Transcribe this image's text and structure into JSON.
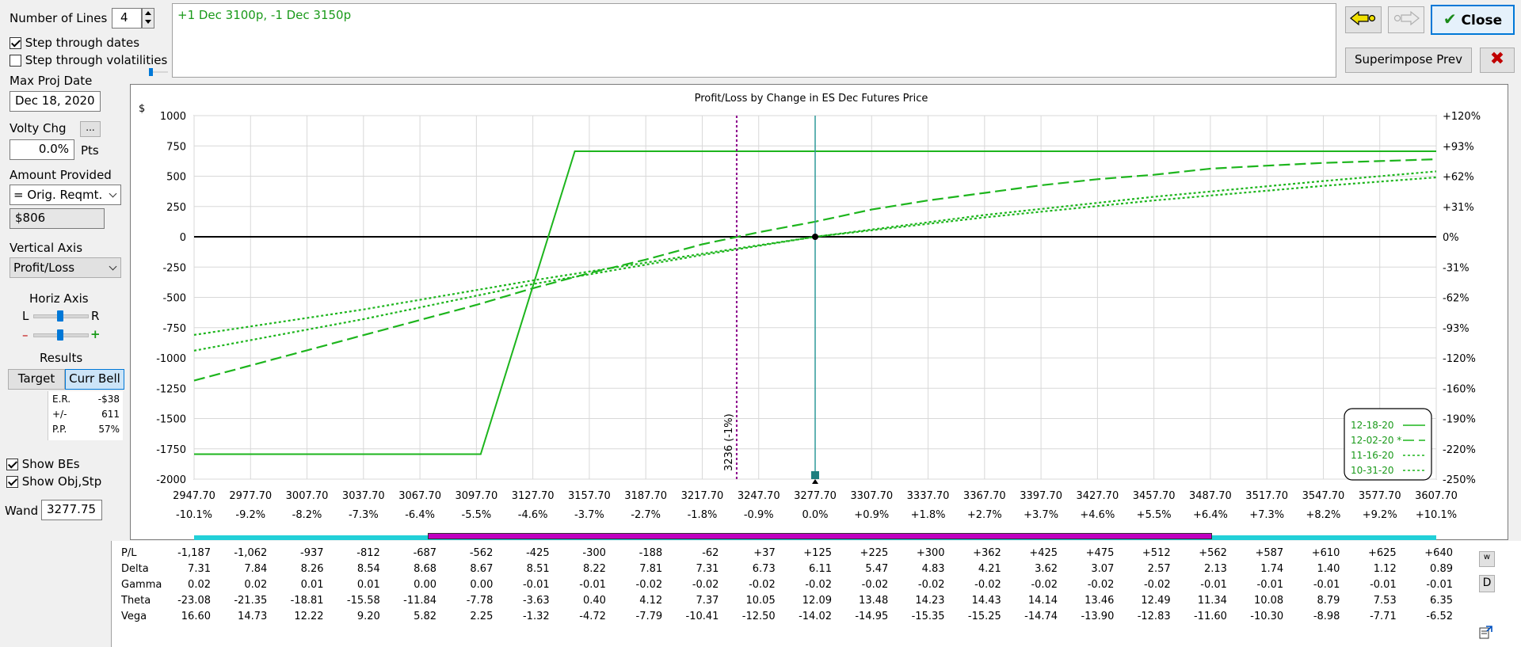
{
  "controls": {
    "num_lines_label": "Number of Lines",
    "num_lines_value": "4",
    "step_dates_label": "Step through dates",
    "step_dates_checked": true,
    "step_vols_label": "Step through volatilities",
    "step_vols_checked": false,
    "max_proj_date_label": "Max Proj Date",
    "max_proj_date_value": "Dec 18, 2020",
    "volty_chg_label": "Volty Chg",
    "volty_chg_button": "...",
    "volty_chg_value": "0.0%",
    "volty_units": "Pts",
    "amount_provided_label": "Amount Provided",
    "amount_provided_selected": "= Orig. Reqmt.",
    "amount_value": "$806",
    "vertical_axis_label": "Vertical Axis",
    "vertical_axis_selected": "Profit/Loss",
    "horiz_axis_label": "Horiz Axis",
    "horiz_left": "L",
    "horiz_right": "R",
    "horiz_minus": "–",
    "horiz_plus": "+",
    "results_label": "Results",
    "target_button": "Target",
    "curr_bell_button": "Curr Bell",
    "stats": [
      {
        "label": "E.R.",
        "value": "-$38"
      },
      {
        "label": "+/-",
        "value": "611"
      },
      {
        "label": "P.P.",
        "value": "57%"
      }
    ],
    "show_bes_label": "Show BEs",
    "show_bes_checked": true,
    "show_obj_label": "Show Obj,Stp",
    "show_obj_checked": true,
    "wand_label": "Wand",
    "wand_value": "3277.75"
  },
  "position_text": "+1 Dec 3100p, -1 Dec 3150p",
  "toolbar": {
    "close_label": "Close",
    "superimpose_label": "Superimpose Prev"
  },
  "colors": {
    "position_text": "#1a9a1a",
    "line": "#1db51d",
    "breakeven": "#8b008b",
    "wand_line": "#2e9a9a",
    "range_cyan": "#22d0d8",
    "range_magenta": "#c000c0"
  },
  "chart_data": {
    "type": "line",
    "title": "Profit/Loss by Change in ES Dec Futures Price",
    "ylabel_left": "$",
    "xlim": [
      2947.7,
      3607.7
    ],
    "ylim": [
      -2000,
      1000
    ],
    "x_ticks": [
      "2947.70",
      "2977.70",
      "3007.70",
      "3037.70",
      "3067.70",
      "3097.70",
      "3127.70",
      "3157.70",
      "3187.70",
      "3217.70",
      "3247.70",
      "3277.70",
      "3307.70",
      "3337.70",
      "3367.70",
      "3397.70",
      "3427.70",
      "3457.70",
      "3487.70",
      "3517.70",
      "3547.70",
      "3577.70",
      "3607.70"
    ],
    "x_pct_ticks": [
      "-10.1%",
      "-9.2%",
      "-8.2%",
      "-7.3%",
      "-6.4%",
      "-5.5%",
      "-4.6%",
      "-3.7%",
      "-2.7%",
      "-1.8%",
      "-0.9%",
      "0.0%",
      "+0.9%",
      "+1.8%",
      "+2.7%",
      "+3.7%",
      "+4.6%",
      "+5.5%",
      "+6.4%",
      "+7.3%",
      "+8.2%",
      "+9.2%",
      "+10.1%"
    ],
    "y_ticks": [
      1000,
      750,
      500,
      250,
      0,
      -250,
      -500,
      -750,
      -1000,
      -1250,
      -1500,
      -1750,
      -2000
    ],
    "y_right_ticks": [
      "+120%",
      "+93%",
      "+62%",
      "+31%",
      "0%",
      "-31%",
      "-62%",
      "-93%",
      "-120%",
      "-160%",
      "-190%",
      "-220%",
      "-250%"
    ],
    "breakeven": {
      "x": 3236,
      "label": "3236 (-1%)"
    },
    "current_price": 3277.7,
    "legend": [
      "12-18-20",
      "12-02-20 *",
      "11-16-20",
      "10-31-20"
    ],
    "series": [
      {
        "name": "12-18-20",
        "style": "solid",
        "x": [
          2947.7,
          3100,
          3150,
          3607.7
        ],
        "y": [
          -1794,
          -1794,
          706,
          706
        ]
      },
      {
        "name": "12-02-20 *",
        "style": "dashed",
        "x": [
          2947.7,
          2977.7,
          3007.7,
          3037.7,
          3067.7,
          3097.7,
          3127.7,
          3157.7,
          3187.7,
          3217.7,
          3247.7,
          3277.7,
          3307.7,
          3337.7,
          3367.7,
          3397.7,
          3427.7,
          3457.7,
          3487.7,
          3517.7,
          3547.7,
          3577.7,
          3607.7
        ],
        "y": [
          -1187,
          -1062,
          -937,
          -812,
          -687,
          -562,
          -425,
          -300,
          -188,
          -62,
          37,
          125,
          225,
          300,
          362,
          425,
          475,
          512,
          562,
          587,
          610,
          625,
          640
        ]
      },
      {
        "name": "11-16-20",
        "style": "dotted",
        "x": [
          2947.7,
          3037.7,
          3127.7,
          3217.7,
          3277.7,
          3367.7,
          3457.7,
          3547.7,
          3607.7
        ],
        "y": [
          -940,
          -680,
          -390,
          -150,
          0,
          180,
          330,
          460,
          540
        ]
      },
      {
        "name": "10-31-20",
        "style": "dotted",
        "x": [
          2947.7,
          3037.7,
          3127.7,
          3217.7,
          3277.7,
          3367.7,
          3457.7,
          3547.7,
          3607.7
        ],
        "y": [
          -810,
          -600,
          -360,
          -140,
          0,
          160,
          300,
          420,
          490
        ]
      }
    ]
  },
  "greeks_table": {
    "rows": [
      {
        "name": "P/L",
        "values": [
          "-1,187",
          "-1,062",
          "-937",
          "-812",
          "-687",
          "-562",
          "-425",
          "-300",
          "-188",
          "-62",
          "+37",
          "+125",
          "+225",
          "+300",
          "+362",
          "+425",
          "+475",
          "+512",
          "+562",
          "+587",
          "+610",
          "+625",
          "+640"
        ]
      },
      {
        "name": "Delta",
        "values": [
          "7.31",
          "7.84",
          "8.26",
          "8.54",
          "8.68",
          "8.67",
          "8.51",
          "8.22",
          "7.81",
          "7.31",
          "6.73",
          "6.11",
          "5.47",
          "4.83",
          "4.21",
          "3.62",
          "3.07",
          "2.57",
          "2.13",
          "1.74",
          "1.40",
          "1.12",
          "0.89"
        ]
      },
      {
        "name": "Gamma",
        "values": [
          "0.02",
          "0.02",
          "0.01",
          "0.01",
          "0.00",
          "0.00",
          "-0.01",
          "-0.01",
          "-0.02",
          "-0.02",
          "-0.02",
          "-0.02",
          "-0.02",
          "-0.02",
          "-0.02",
          "-0.02",
          "-0.02",
          "-0.02",
          "-0.01",
          "-0.01",
          "-0.01",
          "-0.01",
          "-0.01"
        ]
      },
      {
        "name": "Theta",
        "values": [
          "-23.08",
          "-21.35",
          "-18.81",
          "-15.58",
          "-11.84",
          "-7.78",
          "-3.63",
          "0.40",
          "4.12",
          "7.37",
          "10.05",
          "12.09",
          "13.48",
          "14.23",
          "14.43",
          "14.14",
          "13.46",
          "12.49",
          "11.34",
          "10.08",
          "8.79",
          "7.53",
          "6.35"
        ]
      },
      {
        "name": "Vega",
        "values": [
          "16.60",
          "14.73",
          "12.22",
          "9.20",
          "5.82",
          "2.25",
          "-1.32",
          "-4.72",
          "-7.79",
          "-10.41",
          "-12.50",
          "-14.02",
          "-14.95",
          "-15.35",
          "-15.25",
          "-14.74",
          "-13.90",
          "-12.83",
          "-11.60",
          "-10.30",
          "-8.98",
          "-7.71",
          "-6.52"
        ]
      }
    ],
    "side_button_w": "w",
    "side_button_d": "D"
  }
}
